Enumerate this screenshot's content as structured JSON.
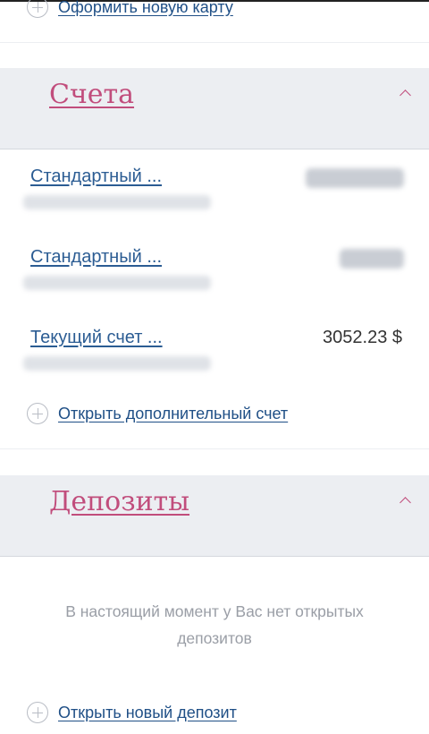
{
  "cards": {
    "issue_new_card_label": "Оформить новую карту"
  },
  "accounts": {
    "title": "Счета",
    "items": [
      {
        "name": "Стандартный ...",
        "balance": "",
        "number": ""
      },
      {
        "name": "Стандартный ...",
        "balance": "",
        "number": ""
      },
      {
        "name": "Текущий счет ...",
        "balance": "3052.23 $",
        "number": ""
      }
    ],
    "open_additional_label": "Открыть дополнительный счет"
  },
  "deposits": {
    "title": "Депозиты",
    "empty_message": "В настоящий момент у Вас нет открытых депозитов",
    "open_new_label": "Открыть новый депозит"
  },
  "colors": {
    "section_title": "#c14d7c",
    "link": "#1f4f86",
    "header_bg": "#eceef2",
    "muted_text": "#9a9ea6"
  },
  "icons": [
    "plus-circle-icon",
    "chevron-up-icon"
  ]
}
